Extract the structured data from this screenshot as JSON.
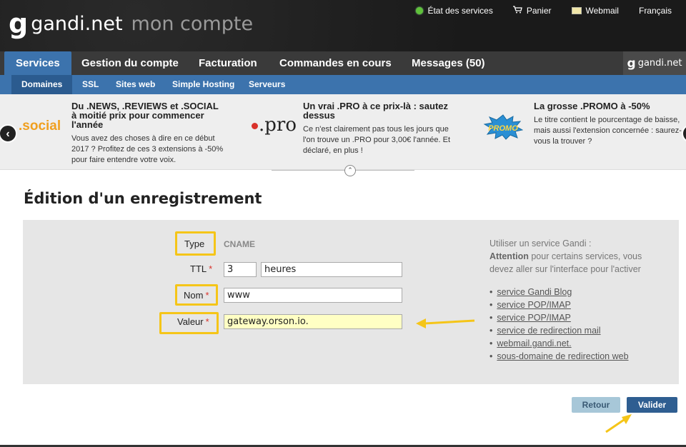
{
  "header": {
    "logo_glyph": "g",
    "brand": "gandi.net",
    "subtitle": "mon compte",
    "links": [
      {
        "label": "État des services",
        "icon": "green-dot-icon"
      },
      {
        "label": "Panier",
        "icon": "cart-icon"
      },
      {
        "label": "Webmail",
        "icon": "mail-icon"
      },
      {
        "label": "Français",
        "icon": ""
      }
    ]
  },
  "mainnav": {
    "tabs": [
      "Services",
      "Gestion du compte",
      "Facturation",
      "Commandes en cours",
      "Messages (50)"
    ],
    "active": "Services",
    "right_logo_glyph": "g",
    "right_logo": "gandi.net"
  },
  "subnav": {
    "items": [
      "Domaines",
      "SSL",
      "Sites web",
      "Simple Hosting",
      "Serveurs"
    ],
    "active": "Domaines"
  },
  "promos": [
    {
      "logo": ".social",
      "title": "Du .NEWS, .REVIEWS et .SOCIAL à moitié prix pour commencer l'année",
      "text": "Vous avez des choses à dire en ce début 2017 ? Profitez de ces 3 extensions à -50% pour faire entendre votre voix."
    },
    {
      "logo": ".pro",
      "title": "Un vrai .PRO à ce prix-là : sautez dessus",
      "text": "Ce n'est clairement pas tous les jours que l'on trouve un .PRO pour 3,00€ l'année. Et déclaré, en plus !"
    },
    {
      "logo": "PROMO",
      "title": "La grosse .PROMO à -50%",
      "text": "Le titre contient le pourcentage de baisse, mais aussi l'extension concernée : saurez-vous la trouver ?"
    }
  ],
  "page_title": "Édition d'un enregistrement",
  "form": {
    "type_label": "Type",
    "type_value": "CNAME",
    "ttl_label": "TTL",
    "ttl_value": "3",
    "ttl_unit": "heures",
    "nom_label": "Nom",
    "nom_value": "www",
    "valeur_label": "Valeur",
    "valeur_value": "gateway.orson.io.",
    "required_mark": "*"
  },
  "help": {
    "intro": "Utiliser un service Gandi :",
    "attention": "Attention",
    "attention_rest": " pour certains services, vous devez aller sur l'interface pour l'activer",
    "services": [
      "service Gandi Blog",
      "service POP/IMAP",
      "service POP/IMAP",
      "service de redirection mail",
      "webmail.gandi.net.",
      "sous-domaine de redirection web"
    ]
  },
  "buttons": {
    "retour": "Retour",
    "valider": "Valider"
  },
  "colors": {
    "accent": "#3c73ad",
    "highlight": "#f5c518",
    "required": "#d9322b"
  }
}
